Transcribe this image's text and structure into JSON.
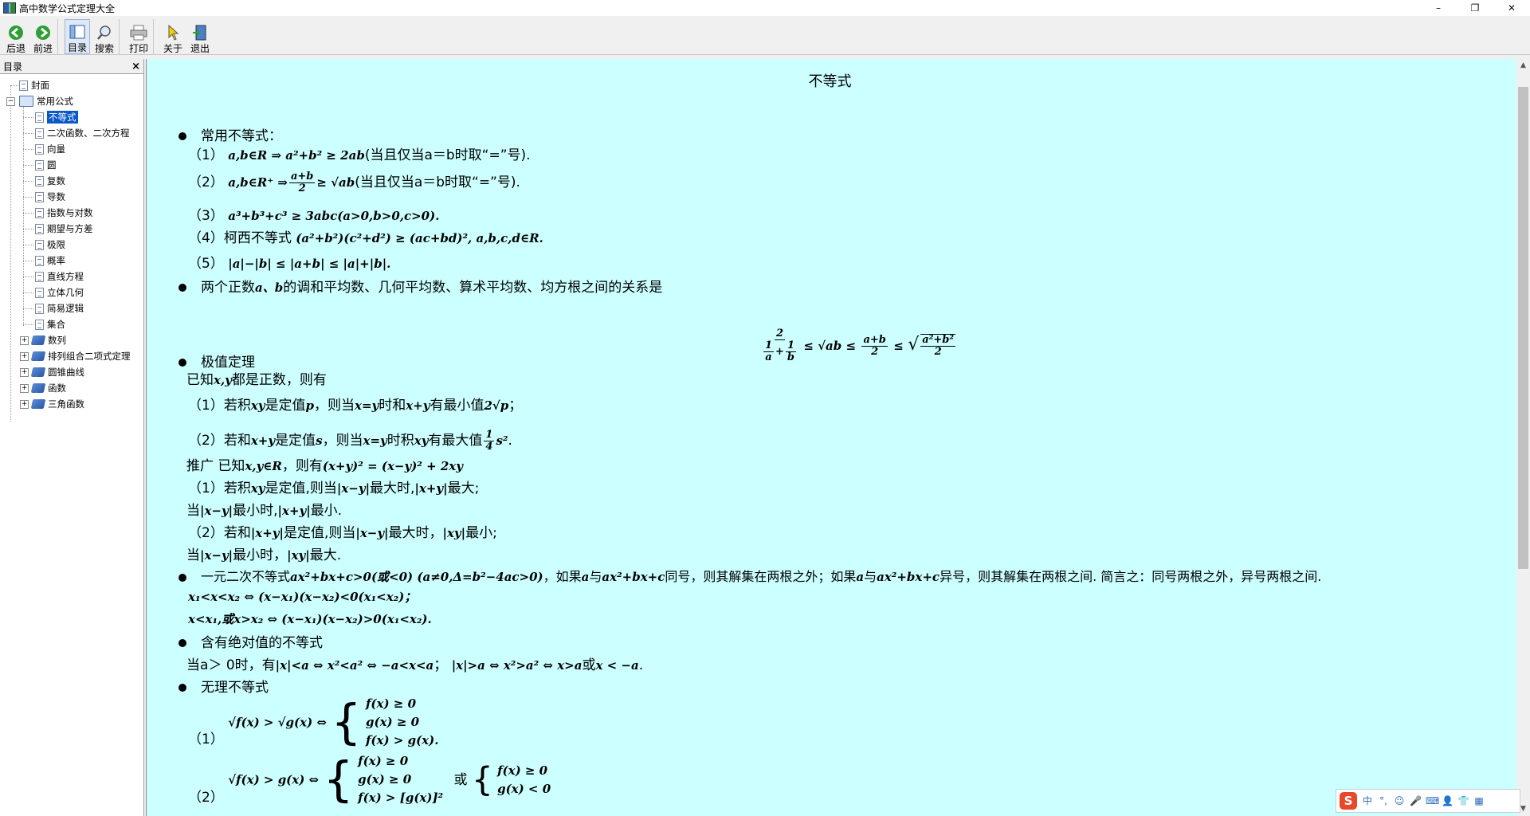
{
  "window": {
    "title": "高中数学公式定理大全",
    "min_glyph": "–",
    "restore_glyph": "❐",
    "close_glyph": "✕"
  },
  "toolbar": {
    "back": "后退",
    "forward": "前进",
    "toc": "目录",
    "search": "搜索",
    "print": "打印",
    "about": "关于",
    "exit": "退出"
  },
  "toc": {
    "header": "目录",
    "close": "×",
    "cover": "封面",
    "common": "常用公式",
    "items": [
      "不等式",
      "二次函数、二次方程",
      "向量",
      "圆",
      "复数",
      "导数",
      "指数与对数",
      "期望与方差",
      "极限",
      "概率",
      "直线方程",
      "立体几何",
      "简易逻辑",
      "集合"
    ],
    "books": [
      "数列",
      "排列组合二项式定理",
      "圆锥曲线",
      "函数",
      "三角函数"
    ]
  },
  "doc": {
    "title": "不等式",
    "common_heading": "常用不等式：",
    "l1_num": "（1）",
    "l1_math": "a,b∈R ⇒ a²+b² ≥ 2ab",
    "l1_note": "(当且仅当a＝b时取“=”号).",
    "l2_num": "（2）",
    "l2_math_a": "a,b∈R⁺ ⇒",
    "l2_frac_num": "a+b",
    "l2_frac_den": "2",
    "l2_math_b": "≥ √ab",
    "l2_note": "(当且仅当a＝b时取“=”号).",
    "l3_num": "（3）",
    "l3_math": "a³+b³+c³ ≥ 3abc(a>0,b>0,c>0).",
    "l4_num": "（4）",
    "l4_text": "柯西不等式",
    "l4_math": "(a²+b²)(c²+d²) ≥ (ac+bd)², a,b,c,d∈R.",
    "l5_num": "（5）",
    "l5_math": "|a|−|b| ≤ |a+b| ≤ |a|+|b|.",
    "means_text_a": "两个正数",
    "means_math": "a、b",
    "means_text_b": "的调和平均数、几何平均数、算术平均数、均方根之间的关系是",
    "means_f_num": "2",
    "means_f_inner_a": "1",
    "means_f_inner_a_den": "a",
    "means_plus": "+",
    "means_f_inner_b": "1",
    "means_f_inner_b_den": "b",
    "means_sqrt": "≤ √ab ≤",
    "means_ab_num": "a+b",
    "means_ab_den": "2",
    "means_rms_leq": "≤",
    "means_rms_num": "a²+b²",
    "means_rms_den": "2",
    "extreme_heading": "极值定理",
    "given_a": "已知",
    "given_math": "x,y",
    "given_b": "都是正数，则有",
    "e1_a": "（1）若积",
    "e1_m1": "xy",
    "e1_b": "是定值",
    "e1_m2": "p",
    "e1_c": "，则当",
    "e1_m3": "x=y",
    "e1_d": "时和",
    "e1_m4": "x+y",
    "e1_e": "有最小值",
    "e1_m5": "2√p",
    "e1_f": "；",
    "e2_a": "（2）若和",
    "e2_m1": "x+y",
    "e2_b": "是定值",
    "e2_m2": "s",
    "e2_c": "，则当",
    "e2_m3": "x=y",
    "e2_d": "时积",
    "e2_m4": "xy",
    "e2_e": "有最大值",
    "e2_frac_num": "1",
    "e2_frac_den": "4",
    "e2_m5": "s²",
    "e2_f": ".",
    "gen_a": "推广  已知",
    "gen_m1": "x,y∈R",
    "gen_b": "，则有",
    "gen_m2": "(x+y)² = (x−y)² + 2xy",
    "g1_a": "（1）若积",
    "g1_m1": "xy",
    "g1_b": "是定值,则当",
    "g1_m2": "|x−y|",
    "g1_c": "最大时,",
    "g1_m3": "|x+y|",
    "g1_d": "最大;",
    "g1b_a": "当",
    "g1b_m1": "|x−y|",
    "g1b_b": "最小时,",
    "g1b_m2": "|x+y|",
    "g1b_c": "最小.",
    "g2_a": "（2）若和",
    "g2_m1": "|x+y|",
    "g2_b": "是定值,则当",
    "g2_m2": "|x−y|",
    "g2_c": "最大时，",
    "g2_m3": "|xy|",
    "g2_d": "最小;",
    "g2b_a": "当",
    "g2b_m1": "|x−y|",
    "g2b_b": "最小时，",
    "g2b_m2": "|xy|",
    "g2b_c": "最大.",
    "quad_a": "一元二次不等式",
    "quad_m1": "ax²+bx+c>0(或<0) (a≠0,Δ=b²−4ac>0)",
    "quad_b": "，如果",
    "quad_m2": "a",
    "quad_c": "与",
    "quad_m3": "ax²+bx+c",
    "quad_d": "同号，则其解集在两根之外；如果",
    "quad_m4": "a",
    "quad_e": "与",
    "quad_m5": "ax²+bx+c",
    "quad_f": "异号，则其解集在两根之间. 简言之：同号两根之外，异号两根之间.",
    "quad_l1": "x₁<x<x₂ ⇔ (x−x₁)(x−x₂)<0(x₁<x₂)；",
    "quad_l2": "x<x₁,或x>x₂ ⇔ (x−x₁)(x−x₂)>0(x₁<x₂).",
    "abs_heading": "含有绝对值的不等式",
    "abs_a": "当a＞ 0时，有",
    "abs_m1": "|x|<a ⇔ x²<a² ⇔ −a<x<a",
    "abs_b": "；",
    "abs_m2": "|x|>a ⇔ x²>a² ⇔ x>a",
    "abs_c": "或",
    "abs_m3": "x < −a",
    "abs_d": ".",
    "irr_heading": "无理不等式",
    "irr1_num": "（1）",
    "irr1_lhs": "√f(x) > √g(x) ⇔",
    "irr1_c1": "f(x) ≥ 0",
    "irr1_c2": "g(x) ≥ 0",
    "irr1_c3": "f(x) > g(x).",
    "irr2_num": "（2）",
    "irr2_lhs": "√f(x) > g(x) ⇔",
    "irr2_c1": "f(x) ≥ 0",
    "irr2_c2": "g(x) ≥ 0",
    "irr2_c3": "f(x) > [g(x)]²",
    "irr2_or": "或",
    "irr2_d1": "f(x) ≥ 0",
    "irr2_d2": "g(x) < 0"
  },
  "ime": {
    "logo": "S",
    "mode": "中",
    "punct": "°,",
    "emoji": "☺",
    "mic": "🎤",
    "kbd": "⌨",
    "user": "👤",
    "shirt": "👕",
    "grid": "▦"
  }
}
